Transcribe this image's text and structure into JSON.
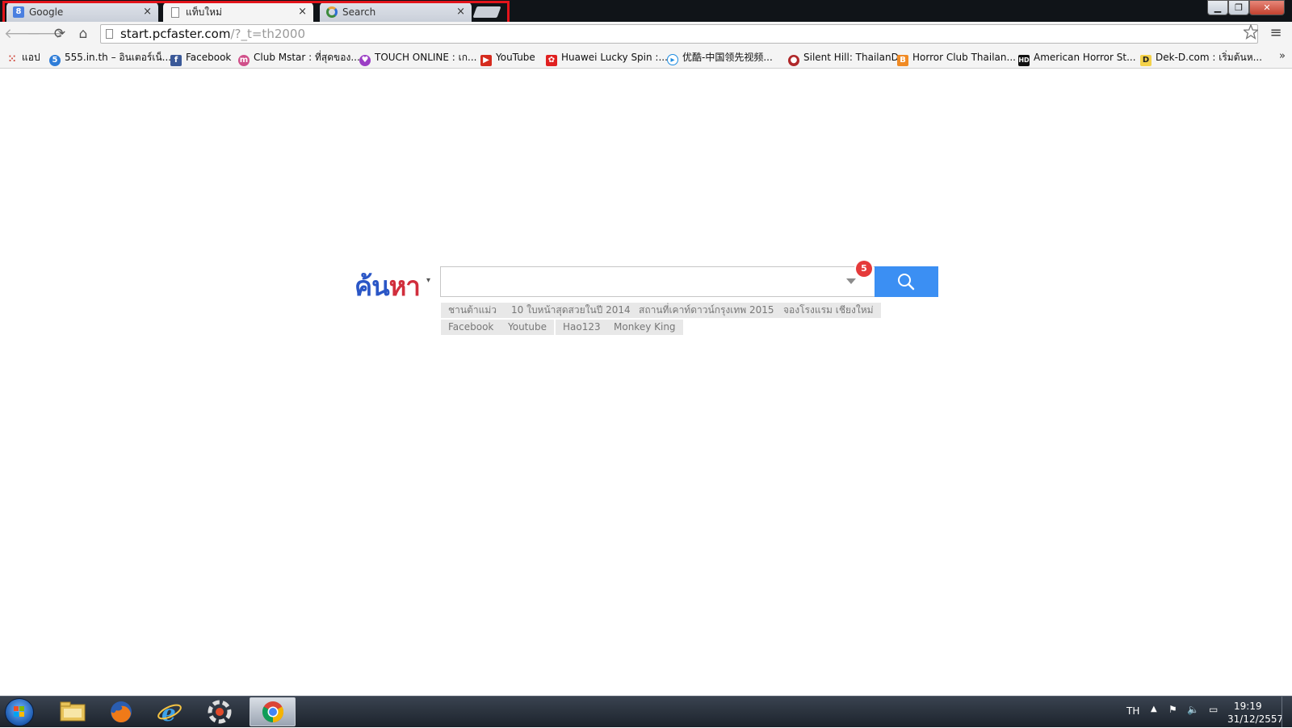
{
  "browser": {
    "tabs": [
      {
        "title": "Google",
        "icon": "google-icon"
      },
      {
        "title": "แท็บใหม่",
        "icon": "page-icon"
      },
      {
        "title": "Search",
        "icon": "search-engine-icon"
      }
    ],
    "tab_close": "×",
    "window_buttons": {
      "minimize": "▁",
      "maximize": "❐",
      "close": "✕"
    },
    "url_host": "start.pcfaster.com",
    "url_path": "/?_t=th2000",
    "bookmarks": [
      {
        "label": "แอป",
        "icon": "apps-grid-icon"
      },
      {
        "label": "555.in.th – อินเตอร์เน็...",
        "icon": "555-icon"
      },
      {
        "label": "Facebook",
        "icon": "facebook-icon"
      },
      {
        "label": "Club Mstar : ที่สุดของ...",
        "icon": "mstar-icon"
      },
      {
        "label": "TOUCH ONLINE : เก...",
        "icon": "touch-online-icon"
      },
      {
        "label": "YouTube",
        "icon": "youtube-icon"
      },
      {
        "label": "Huawei Lucky Spin :...",
        "icon": "huawei-icon"
      },
      {
        "label": "优酷-中国领先视频...",
        "icon": "youku-icon"
      },
      {
        "label": "Silent Hill: ThailanD",
        "icon": "silent-hill-icon"
      },
      {
        "label": "Horror Club Thailan...",
        "icon": "blogger-icon"
      },
      {
        "label": "American Horror St...",
        "icon": "hd-icon"
      },
      {
        "label": "Dek-D.com : เริ่มต้นห...",
        "icon": "dekd-icon"
      }
    ],
    "bookmarks_more": "»"
  },
  "search": {
    "logo_part1": "ค้น",
    "logo_part2": "หา",
    "logo_caret": "▾",
    "badge_count": "5",
    "chips_row1": [
      "ชานต้าแม่ว",
      "10 ใบหน้าสุดสวยในปี 2014",
      "สถานที่เคาท์ดาวน์กรุงเทพ 2015",
      "จองโรงแรม เชียงใหม่"
    ],
    "chips_row2": [
      "Facebook",
      "Youtube",
      "Hao123",
      "Monkey King"
    ]
  },
  "taskbar": {
    "apps": [
      "start-button",
      "file-explorer-icon",
      "firefox-icon",
      "internet-explorer-icon",
      "camera-app-icon",
      "chrome-icon"
    ],
    "language": "TH",
    "time": "19:19",
    "date": "31/12/2557"
  },
  "colors": {
    "logo_blue": "#2a56c6",
    "logo_red": "#d12e3c",
    "search_button": "#3b8ff3",
    "highlight_box": "#e3141b"
  }
}
